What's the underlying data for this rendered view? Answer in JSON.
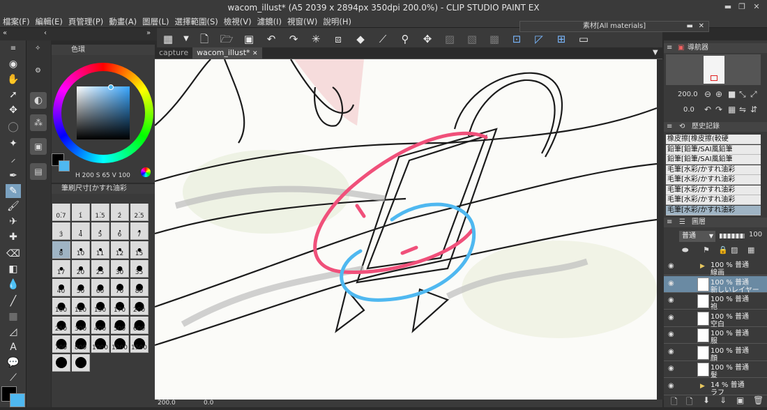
{
  "window": {
    "title": "wacom_illust* (A5 2039 x 2894px 350dpi 200.0%) - CLIP STUDIO PAINT EX"
  },
  "menu": [
    "檔案(F)",
    "編輯(E)",
    "頁管理(P)",
    "動畫(A)",
    "圖層(L)",
    "選擇範圍(S)",
    "檢視(V)",
    "濾鏡(I)",
    "視窗(W)",
    "說明(H)"
  ],
  "materials_panel": {
    "title": "素材[All materials]"
  },
  "tabs": [
    {
      "label": "capture",
      "active": false
    },
    {
      "label": "wacom_illust*",
      "active": true
    }
  ],
  "color_panel": {
    "title": "色環",
    "h": "200",
    "s": "65",
    "v": "100",
    "h_label": "H",
    "s_label": "S",
    "v_label": "V"
  },
  "brush_panel": {
    "title": "筆刷尺寸[かすれ油彩",
    "sizes": [
      "0.7",
      "1",
      "1.5",
      "2",
      "2.5",
      "3",
      "4",
      "5",
      "6",
      "7",
      "8",
      "10",
      "11",
      "12",
      "15",
      "17",
      "20",
      "25",
      "30",
      "35",
      "40",
      "50",
      "60",
      "70",
      "80",
      "100",
      "120",
      "150",
      "170",
      "200",
      "250",
      "300",
      "400",
      "500",
      "600",
      "700",
      "800",
      "1000",
      "1200",
      "1500",
      "",
      ""
    ],
    "selected": "8"
  },
  "navigator": {
    "title": "導航器",
    "zoom": "200.0",
    "rotate": "0.0"
  },
  "history": {
    "title": "歷史記錄",
    "items": [
      {
        "label": "橡皮擦[橡皮擦(較硬",
        "selected": false
      },
      {
        "label": "鉛筆[鉛筆/SAI風鉛筆",
        "selected": false
      },
      {
        "label": "鉛筆[鉛筆/SAI風鉛筆",
        "selected": false
      },
      {
        "label": "毛筆[水彩/かすれ油彩",
        "selected": false
      },
      {
        "label": "毛筆[水彩/かすれ油彩",
        "selected": false
      },
      {
        "label": "毛筆[水彩/かすれ油彩",
        "selected": false
      },
      {
        "label": "毛筆[水彩/かすれ油彩",
        "selected": false
      },
      {
        "label": "毛筆[水彩/かすれ油彩",
        "selected": true
      }
    ]
  },
  "layers": {
    "title": "圖層",
    "blend": "普通",
    "opacity": "100",
    "items": [
      {
        "line1": "100 % 普通",
        "line2": "線画",
        "type": "folder",
        "selected": false
      },
      {
        "line1": "100 % 普通",
        "line2": "新しいレイヤー",
        "type": "layer",
        "selected": true
      },
      {
        "line1": "100 % 普通",
        "line2": "袍",
        "type": "layer",
        "selected": false
      },
      {
        "line1": "100 % 普通",
        "line2": "空白",
        "type": "layer",
        "selected": false
      },
      {
        "line1": "100 % 普通",
        "line2": "服",
        "type": "layer",
        "selected": false
      },
      {
        "line1": "100 % 普通",
        "line2": "顔",
        "type": "layer",
        "selected": false
      },
      {
        "line1": "100 % 普通",
        "line2": "髮",
        "type": "layer",
        "selected": false
      },
      {
        "line1": "14 % 普通",
        "line2": "ラフ",
        "type": "folder",
        "selected": false
      }
    ]
  },
  "status": {
    "zoom": "200.0",
    "rotate": "0.0"
  },
  "colors": {
    "accent": "#7aa1c0",
    "pink": "#f0507a",
    "blue": "#4fb8f0"
  }
}
